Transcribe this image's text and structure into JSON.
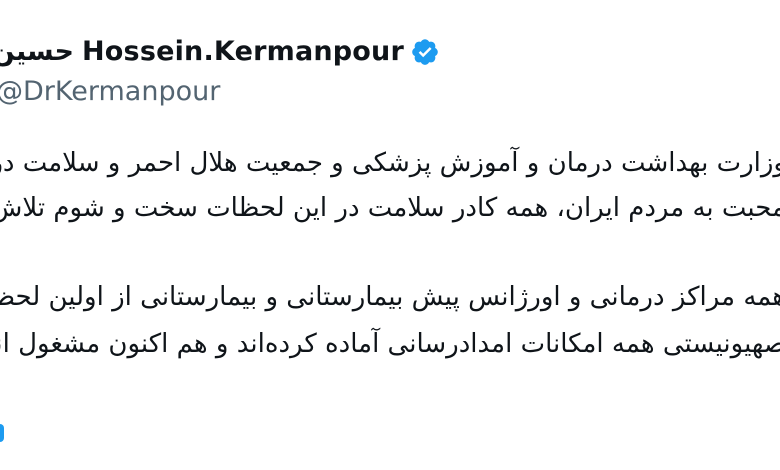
{
  "header": {
    "display_name_en": "Hossein.Kermanpour",
    "display_name_fa": "حسین کرمانپور",
    "handle": "@DrKermanpour",
    "verified_icon": "verified-badge-icon",
    "verified_color": "#1d9bf0"
  },
  "body": {
    "line1": "وزارت بهداشت درمان و آموزش پزشکی و جمعیت هلال احمر و سلامت  در آماده باش کامل است و با تمام وجود و قلبی آکنده از",
    "line2": "محبت به مردم ایران، همه کادر سلامت در این لحظات سخت و شوم تلاش خواهد کرد نهایت سعی خود در حفظ جان مردم شریف",
    "line3": "همه مراکز درمانی و اورژانس پیش بیمارستانی و بیمارستانی از اولین لحظات حملات رژیم",
    "line4": "صهیونیستی همه امکانات امدادرسانی آماده کرده‌اند و هم اکنون مشغول انتقال حادثه‌دیدگان هستند"
  }
}
